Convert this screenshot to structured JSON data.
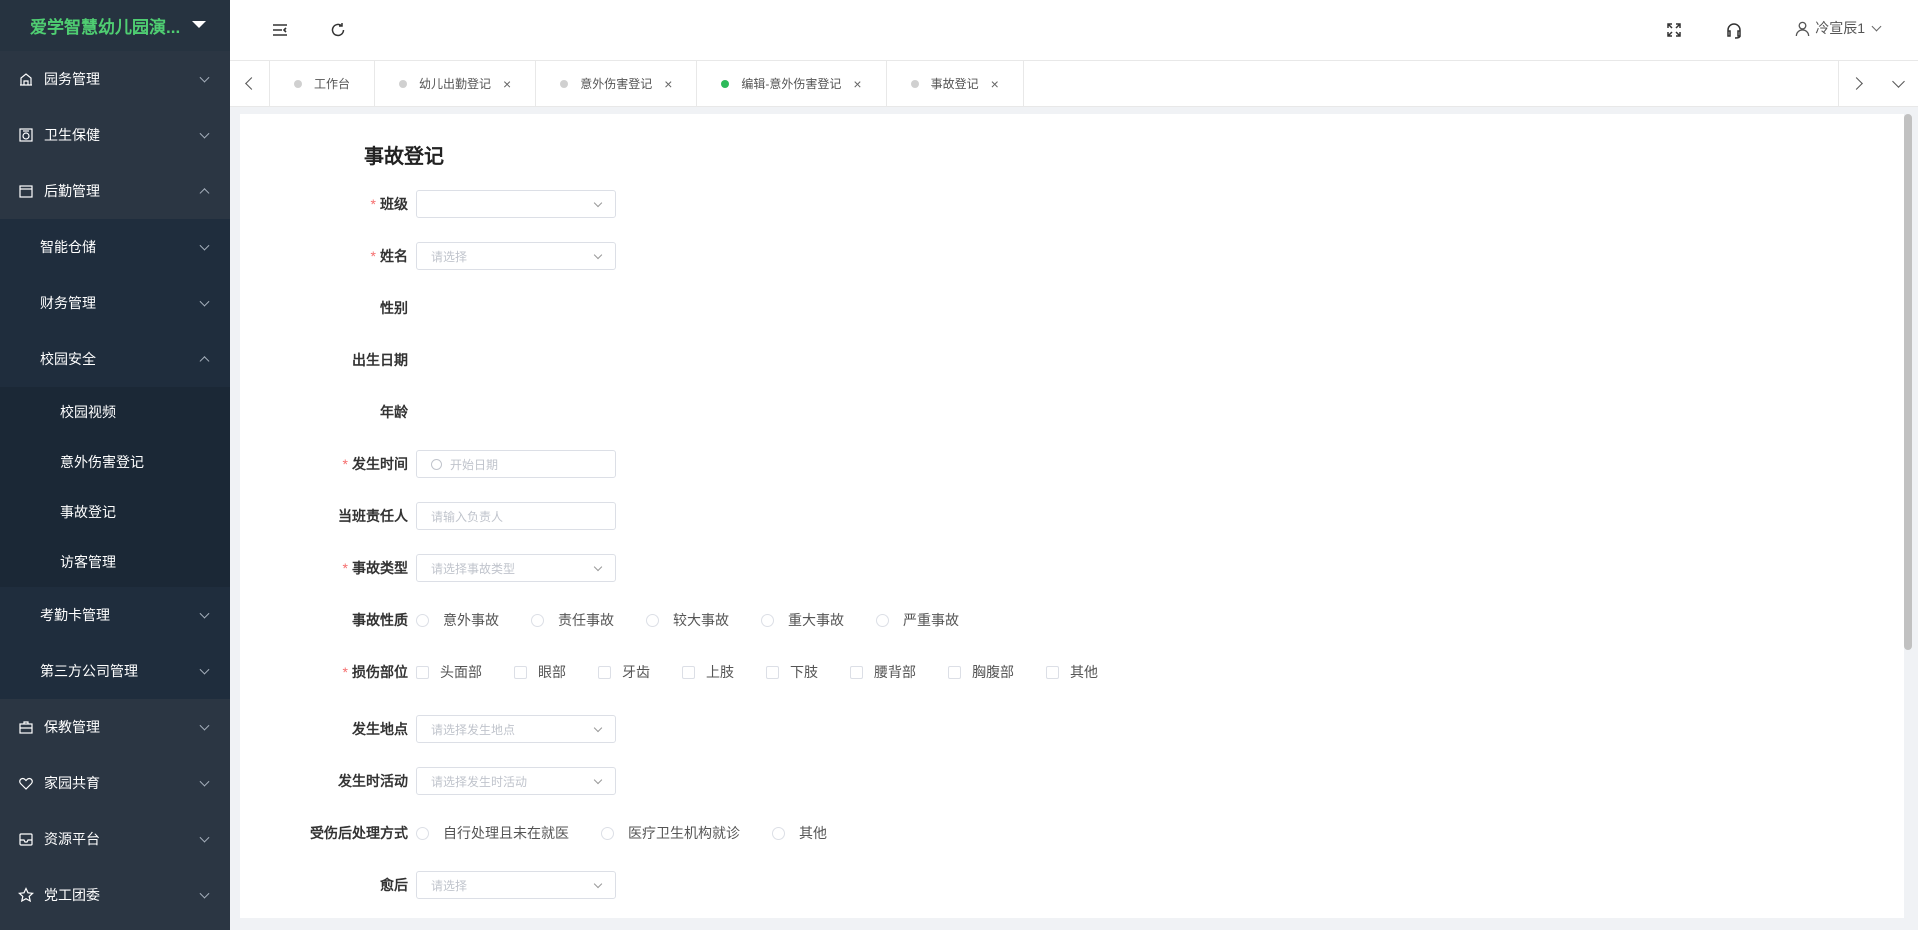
{
  "app": {
    "brand": "爱学智慧幼儿园演...",
    "user": "冷宣辰1"
  },
  "sidebar": {
    "items": [
      {
        "label": "园务管理",
        "icon": "building-icon",
        "expanded": false
      },
      {
        "label": "卫生保健",
        "icon": "health-icon",
        "expanded": false
      },
      {
        "label": "后勤管理",
        "icon": "logistics-icon",
        "expanded": true,
        "children": [
          {
            "label": "智能仓储",
            "expanded": false
          },
          {
            "label": "财务管理",
            "expanded": false
          },
          {
            "label": "校园安全",
            "expanded": true,
            "children": [
              {
                "label": "校园视频"
              },
              {
                "label": "意外伤害登记"
              },
              {
                "label": "事故登记"
              },
              {
                "label": "访客管理"
              }
            ]
          },
          {
            "label": "考勤卡管理",
            "expanded": false
          },
          {
            "label": "第三方公司管理",
            "expanded": false
          }
        ]
      },
      {
        "label": "保教管理",
        "icon": "briefcase-icon",
        "expanded": false
      },
      {
        "label": "家园共育",
        "icon": "heart-icon",
        "expanded": false
      },
      {
        "label": "资源平台",
        "icon": "inbox-icon",
        "expanded": false
      },
      {
        "label": "党工团委",
        "icon": "star-icon",
        "expanded": false
      }
    ]
  },
  "tabs": [
    {
      "label": "工作台",
      "closable": false,
      "active": false
    },
    {
      "label": "幼儿出勤登记",
      "closable": true,
      "active": false
    },
    {
      "label": "意外伤害登记",
      "closable": true,
      "active": false
    },
    {
      "label": "编辑-意外伤害登记",
      "closable": true,
      "active": true
    },
    {
      "label": "事故登记",
      "closable": true,
      "active": false
    }
  ],
  "tab_close": "×",
  "form": {
    "title": "事故登记",
    "class_label": "班级",
    "class_value": "",
    "name_label": "姓名",
    "name_placeholder": "请选择",
    "gender_label": "性别",
    "birth_label": "出生日期",
    "age_label": "年龄",
    "time_label": "发生时间",
    "time_placeholder": "开始日期",
    "person_label": "当班责任人",
    "person_placeholder": "请输入负责人",
    "type_label": "事故类型",
    "type_placeholder": "请选择事故类型",
    "nature_label": "事故性质",
    "nature_options": [
      "意外事故",
      "责任事故",
      "较大事故",
      "重大事故",
      "严重事故"
    ],
    "injury_label": "损伤部位",
    "injury_options": [
      "头面部",
      "眼部",
      "牙齿",
      "上肢",
      "下肢",
      "腰背部",
      "胸腹部",
      "其他"
    ],
    "place_label": "发生地点",
    "place_placeholder": "请选择发生地点",
    "activity_label": "发生时活动",
    "activity_placeholder": "请选择发生时活动",
    "handling_label": "受伤后处理方式",
    "handling_options": [
      "自行处理且未在就医",
      "医疗卫生机构就诊",
      "其他"
    ],
    "recovery_label": "愈后",
    "recovery_placeholder": "请选择"
  }
}
